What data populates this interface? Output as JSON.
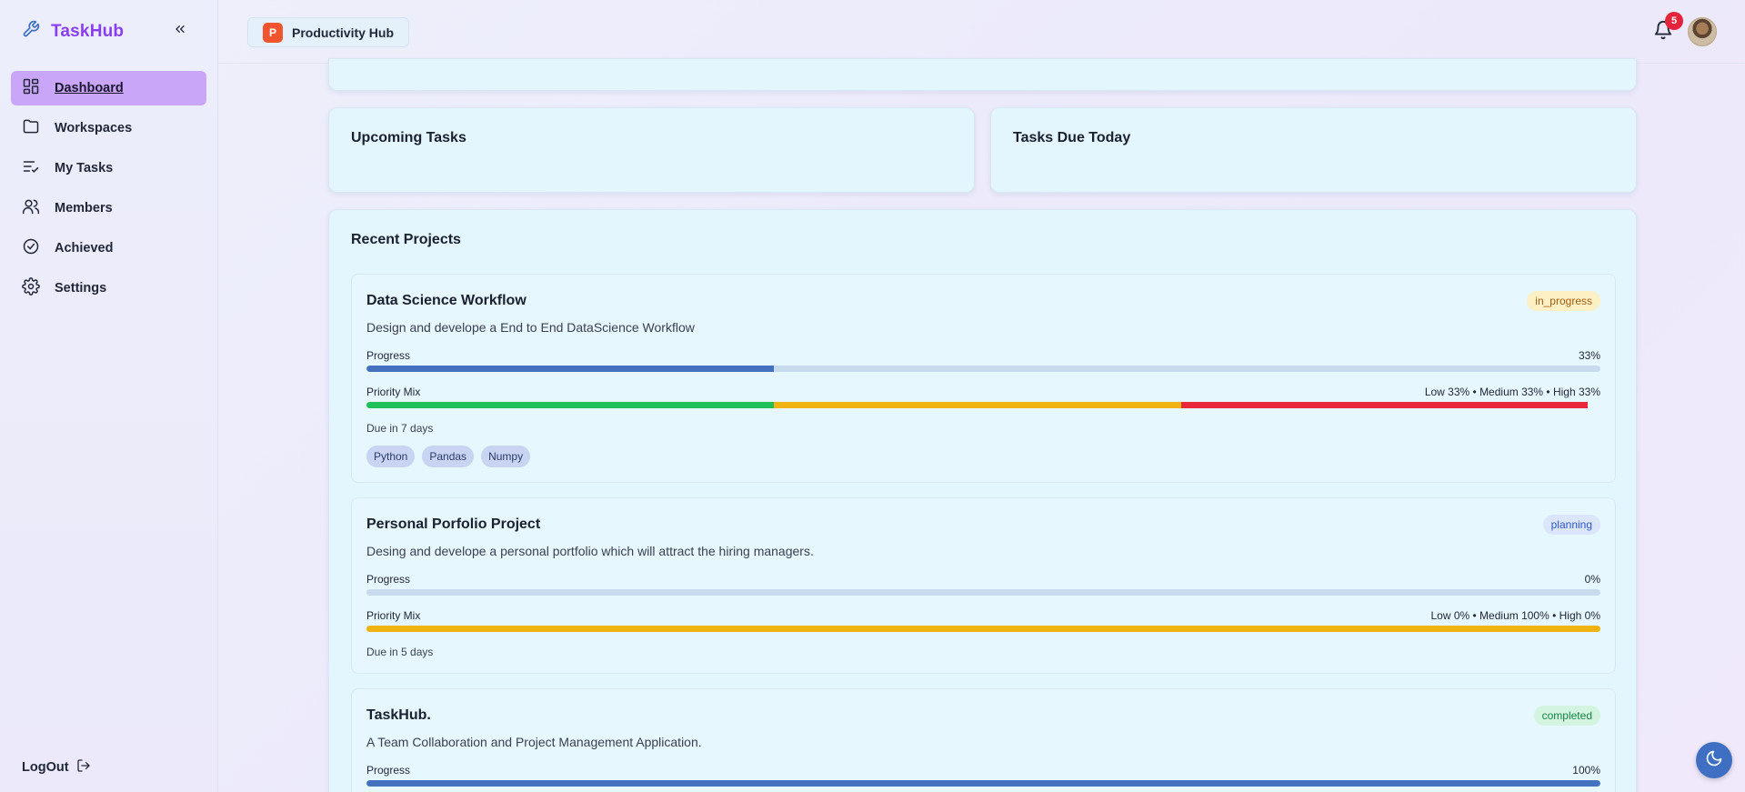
{
  "app": {
    "name": "TaskHub"
  },
  "sidebar": {
    "items": [
      {
        "label": "Dashboard",
        "icon": "grid-icon",
        "active": true
      },
      {
        "label": "Workspaces",
        "icon": "folder-icon"
      },
      {
        "label": "My Tasks",
        "icon": "list-check-icon"
      },
      {
        "label": "Members",
        "icon": "users-icon"
      },
      {
        "label": "Achieved",
        "icon": "check-circle-icon"
      },
      {
        "label": "Settings",
        "icon": "gear-icon"
      }
    ],
    "logout_label": "LogOut"
  },
  "header": {
    "workspace": {
      "initial": "P",
      "name": "Productivity Hub",
      "color": "#f1552f"
    },
    "notifications_count": "5"
  },
  "cards": {
    "upcoming_title": "Upcoming Tasks",
    "due_today_title": "Tasks Due Today",
    "recent_projects_title": "Recent Projects"
  },
  "labels": {
    "progress": "Progress",
    "priority_mix": "Priority Mix"
  },
  "projects": [
    {
      "name": "Data Science Workflow",
      "status": "in_progress",
      "description": "Design and develope a End to End DataScience Workflow",
      "progress_text": "33%",
      "progress": 0.33,
      "priority_text": "Low 33% • Medium 33% • High 33%",
      "priority": {
        "low": 0.33,
        "medium": 0.33,
        "high": 0.33
      },
      "due": "Due in 7 days",
      "tags": [
        "Python",
        "Pandas",
        "Numpy"
      ]
    },
    {
      "name": "Personal Porfolio Project",
      "status": "planning",
      "description": "Desing and develope a personal portfolio which will attract the hiring managers.",
      "progress_text": "0%",
      "progress": 0,
      "priority_text": "Low 0% • Medium 100% • High 0%",
      "priority": {
        "low": 0,
        "medium": 1,
        "high": 0
      },
      "due": "Due in 5 days",
      "tags": []
    },
    {
      "name": "TaskHub.",
      "status": "completed",
      "description": "A Team Collaboration and Project Management Application.",
      "progress_text": "100%",
      "progress": 1
    }
  ],
  "colors": {
    "accent": "#8a3ef2",
    "progress": "#4472c0",
    "low": "#1fbf5a",
    "medium": "#f0b311",
    "high": "#e8273a"
  }
}
